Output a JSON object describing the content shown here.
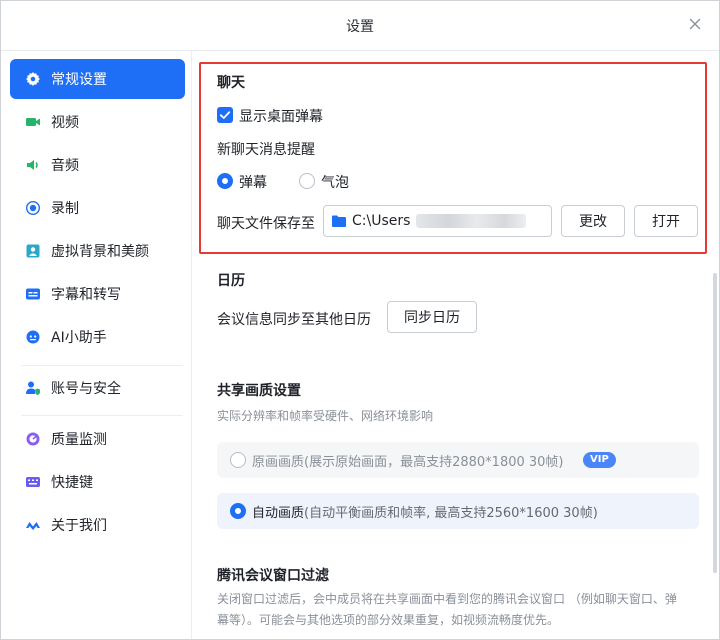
{
  "window": {
    "title": "设置"
  },
  "sidebar": {
    "items": [
      {
        "label": "常规设置",
        "icon": "gear-icon",
        "active": true
      },
      {
        "label": "视频",
        "icon": "video-camera-icon"
      },
      {
        "label": "音频",
        "icon": "speaker-icon"
      },
      {
        "label": "录制",
        "icon": "record-icon"
      },
      {
        "label": "虚拟背景和美颜",
        "icon": "portrait-icon"
      },
      {
        "label": "字幕和转写",
        "icon": "subtitles-icon"
      },
      {
        "label": "AI小助手",
        "icon": "ai-assistant-icon"
      },
      {
        "label": "账号与安全",
        "icon": "account-security-icon"
      },
      {
        "label": "质量监测",
        "icon": "quality-monitor-icon"
      },
      {
        "label": "快捷键",
        "icon": "keyboard-icon"
      },
      {
        "label": "关于我们",
        "icon": "about-logo-icon"
      }
    ]
  },
  "chat": {
    "title": "聊天",
    "show_danmaku_label": "显示桌面弹幕",
    "show_danmaku_checked": true,
    "new_msg_title": "新聊天消息提醒",
    "opt_danmaku": "弹幕",
    "opt_bubble": "气泡",
    "selected": "弹幕",
    "save_label": "聊天文件保存至",
    "save_path": "C:\\Users",
    "change_button": "更改",
    "open_button": "打开"
  },
  "calendar": {
    "title": "日历",
    "sync_label": "会议信息同步至其他日历",
    "sync_button": "同步日历"
  },
  "share_quality": {
    "title": "共享画质设置",
    "subtitle": "实际分辨率和帧率受硬件、网络环境影响",
    "options": [
      {
        "name": "原画画质",
        "desc": "(展示原始画面，最高支持2880*1800 30帧)",
        "badge": "VIP",
        "selected": false
      },
      {
        "name": "自动画质",
        "desc": "(自动平衡画质和帧率, 最高支持2560*1600 30帧)",
        "selected": true
      }
    ]
  },
  "window_filter": {
    "title": "腾讯会议窗口过滤",
    "description": "关闭窗口过滤后，会中成员将在共享画面中看到您的腾讯会议窗口 （例如聊天窗口、弹幕等）。可能会与其他选项的部分效果重复，如视频流畅度优先。"
  },
  "colors": {
    "accent": "#1E6FF5",
    "highlight_border": "#E53935"
  }
}
